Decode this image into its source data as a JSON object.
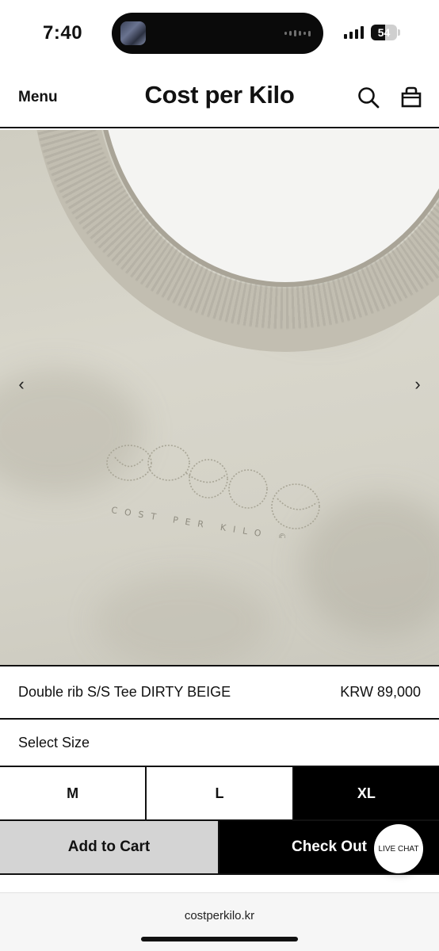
{
  "status_bar": {
    "time": "7:40",
    "battery_level": "54",
    "battery_fraction": 0.54
  },
  "header": {
    "menu_label": "Menu",
    "brand": "Cost per Kilo",
    "search_icon": "search-icon",
    "cart_icon": "shopping-bag-icon"
  },
  "gallery": {
    "prev_glyph": "‹",
    "next_glyph": "›",
    "embroidery_text": "COST PER KILO ©"
  },
  "product": {
    "name": "Double rib S/S Tee DIRTY BEIGE",
    "price": "KRW 89,000"
  },
  "size": {
    "label": "Select Size",
    "options": [
      {
        "label": "M",
        "selected": false
      },
      {
        "label": "L",
        "selected": false
      },
      {
        "label": "XL",
        "selected": true
      }
    ]
  },
  "actions": {
    "add_to_cart": "Add to Cart",
    "check_out": "Check Out"
  },
  "live_chat": "LIVE CHAT",
  "browser": {
    "url": "costperkilo.kr"
  },
  "colors": {
    "accent": "#000000",
    "secondary_button": "#d4d4d4",
    "fabric": "#d4d2c7"
  }
}
